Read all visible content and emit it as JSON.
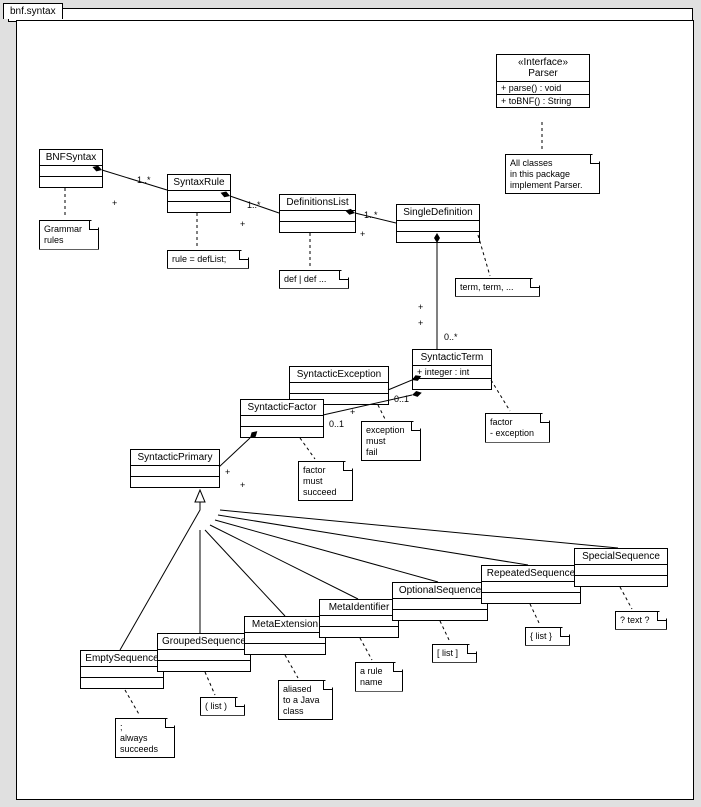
{
  "package": "bnf.syntax",
  "interface": {
    "stereotype": "«Interface»",
    "name": "Parser",
    "op1": "+ parse() : void",
    "op2": "+ toBNF() : String"
  },
  "parserNote": "All classes\nin this package\nimplement Parser.",
  "classes": {
    "bnfSyntax": "BNFSyntax",
    "syntaxRule": "SyntaxRule",
    "definitionsList": "DefinitionsList",
    "singleDefinition": "SingleDefinition",
    "syntacticTerm": "SyntacticTerm",
    "syntacticTermAttr": "+ integer : int",
    "syntacticException": "SyntacticException",
    "syntacticFactor": "SyntacticFactor",
    "syntacticPrimary": "SyntacticPrimary",
    "emptySequence": "EmptySequence",
    "groupedSequence": "GroupedSequence",
    "metaExtension": "MetaExtension",
    "metaIdentifier": "MetaIdentifier",
    "optionalSequence": "OptionalSequence",
    "repeatedSequence": "RepeatedSequence",
    "specialSequence": "SpecialSequence"
  },
  "notes": {
    "grammar": "Grammar\nrules",
    "rule": "rule = defList;",
    "defs": "def | def ...",
    "terms": "term, term, ...",
    "factorExc": "factor\n- exception",
    "excFail": "exception\nmust\nfail",
    "factorSucceed": "factor\nmust\nsucceed",
    "empty": ";\nalways\nsucceeds",
    "grouped": "( list )",
    "metaExt": "aliased\nto a Java\nclass",
    "metaId": "a rule\nname",
    "optional": "[ list ]",
    "repeated": "{ list }",
    "special": "? text ?"
  },
  "mult": {
    "oneStar": "1..*",
    "zeroOne": "0..1",
    "zeroStar": "0..*",
    "plus": "+"
  }
}
